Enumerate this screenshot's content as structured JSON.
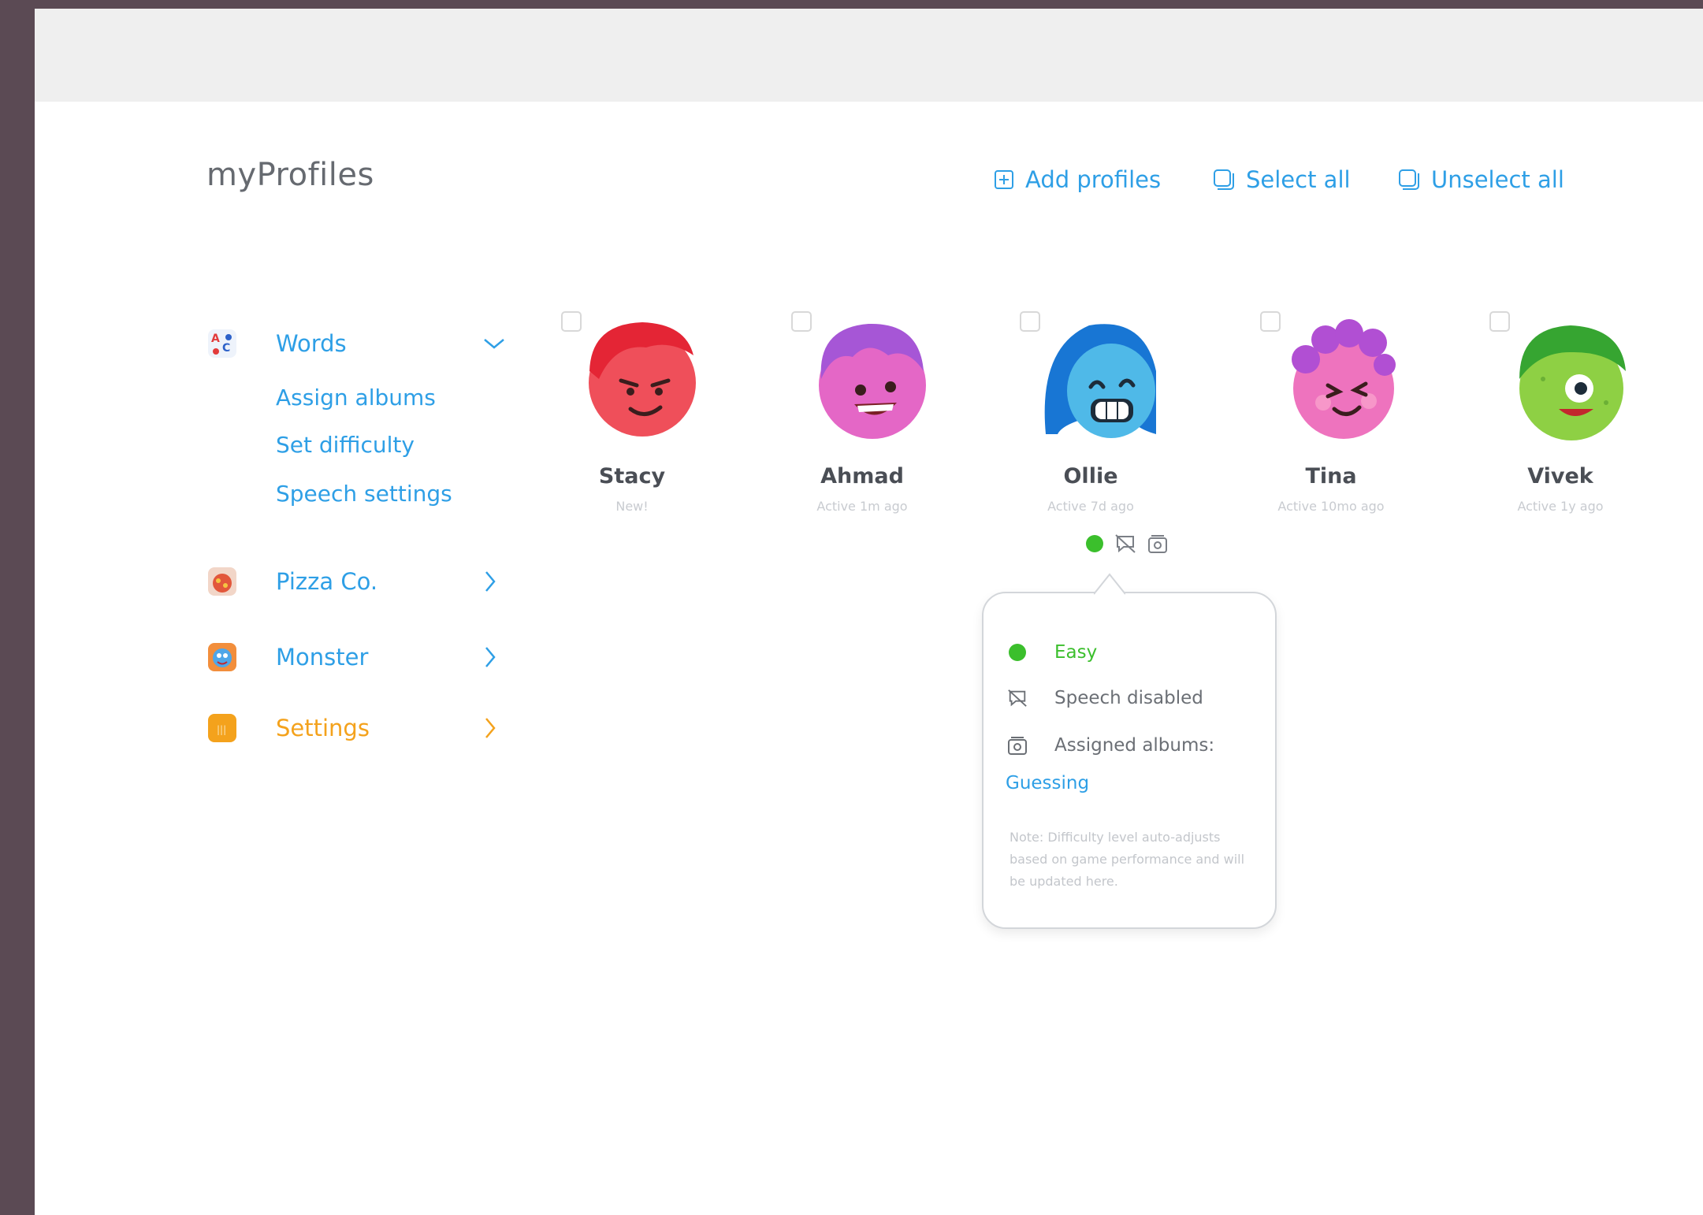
{
  "header": {
    "title": "myProfiles",
    "actions": {
      "add": "Add profiles",
      "select_all": "Select all",
      "unselect_all": "Unselect all"
    }
  },
  "sidebar": {
    "words": {
      "label": "Words",
      "subitems": [
        "Assign albums",
        "Set difficulty",
        "Speech settings"
      ]
    },
    "items": [
      {
        "label": "Pizza Co."
      },
      {
        "label": "Monster"
      },
      {
        "label": "Settings"
      }
    ]
  },
  "profiles": [
    {
      "name": "Stacy",
      "status": "New!",
      "color": "#ef4f5a",
      "hair": "#e42535"
    },
    {
      "name": "Ahmad",
      "status": "Active 1m ago",
      "color": "#e467c6",
      "hair": "#a656d6"
    },
    {
      "name": "Ollie",
      "status": "Active 7d ago",
      "color": "#4fb9e8",
      "hair": "#1876d4"
    },
    {
      "name": "Tina",
      "status": "Active 10mo ago",
      "color": "#ee73be",
      "hair": "#b14fd3"
    },
    {
      "name": "Vivek",
      "status": "Active 1y ago",
      "color": "#8ed044",
      "hair": "#36a531"
    }
  ],
  "popover": {
    "difficulty": "Easy",
    "speech": "Speech disabled",
    "albums_label": "Assigned albums:",
    "album": "Guessing",
    "note": "Note: Difficulty level auto-adjusts based on game performance and will be updated here."
  },
  "colors": {
    "accent": "#2e9fe6",
    "settings": "#f4a21c",
    "easy": "#3bbf2c"
  }
}
